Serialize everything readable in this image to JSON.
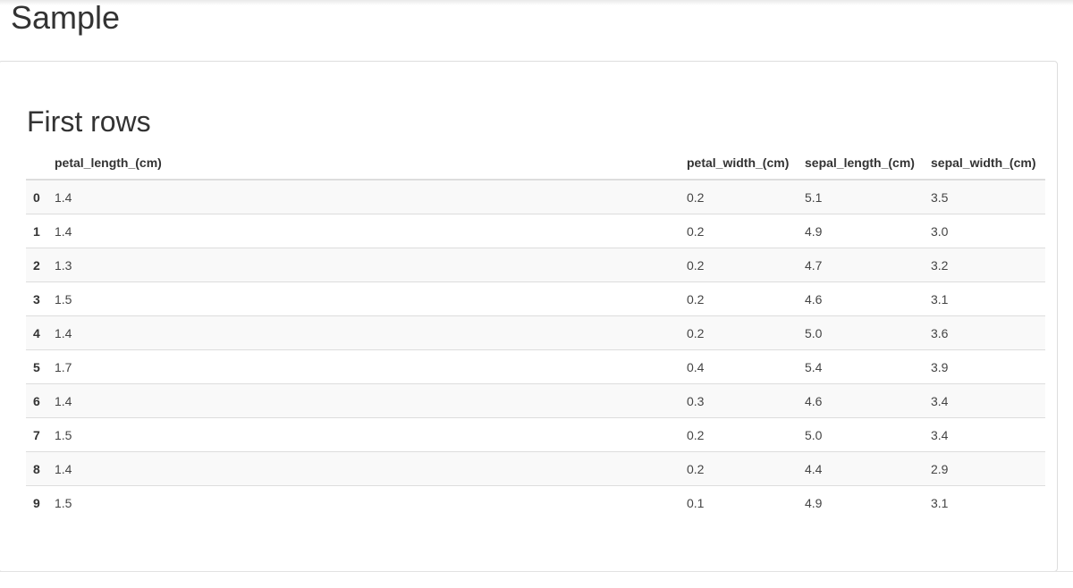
{
  "page": {
    "title": "Sample"
  },
  "section": {
    "title": "First rows"
  },
  "table": {
    "columns": [
      "petal_length_(cm)",
      "petal_width_(cm)",
      "sepal_length_(cm)",
      "sepal_width_(cm)"
    ],
    "rows": [
      {
        "index": "0",
        "values": [
          "1.4",
          "0.2",
          "5.1",
          "3.5"
        ]
      },
      {
        "index": "1",
        "values": [
          "1.4",
          "0.2",
          "4.9",
          "3.0"
        ]
      },
      {
        "index": "2",
        "values": [
          "1.3",
          "0.2",
          "4.7",
          "3.2"
        ]
      },
      {
        "index": "3",
        "values": [
          "1.5",
          "0.2",
          "4.6",
          "3.1"
        ]
      },
      {
        "index": "4",
        "values": [
          "1.4",
          "0.2",
          "5.0",
          "3.6"
        ]
      },
      {
        "index": "5",
        "values": [
          "1.7",
          "0.4",
          "5.4",
          "3.9"
        ]
      },
      {
        "index": "6",
        "values": [
          "1.4",
          "0.3",
          "4.6",
          "3.4"
        ]
      },
      {
        "index": "7",
        "values": [
          "1.5",
          "0.2",
          "5.0",
          "3.4"
        ]
      },
      {
        "index": "8",
        "values": [
          "1.4",
          "0.2",
          "4.4",
          "2.9"
        ]
      },
      {
        "index": "9",
        "values": [
          "1.5",
          "0.1",
          "4.9",
          "3.1"
        ]
      }
    ]
  }
}
